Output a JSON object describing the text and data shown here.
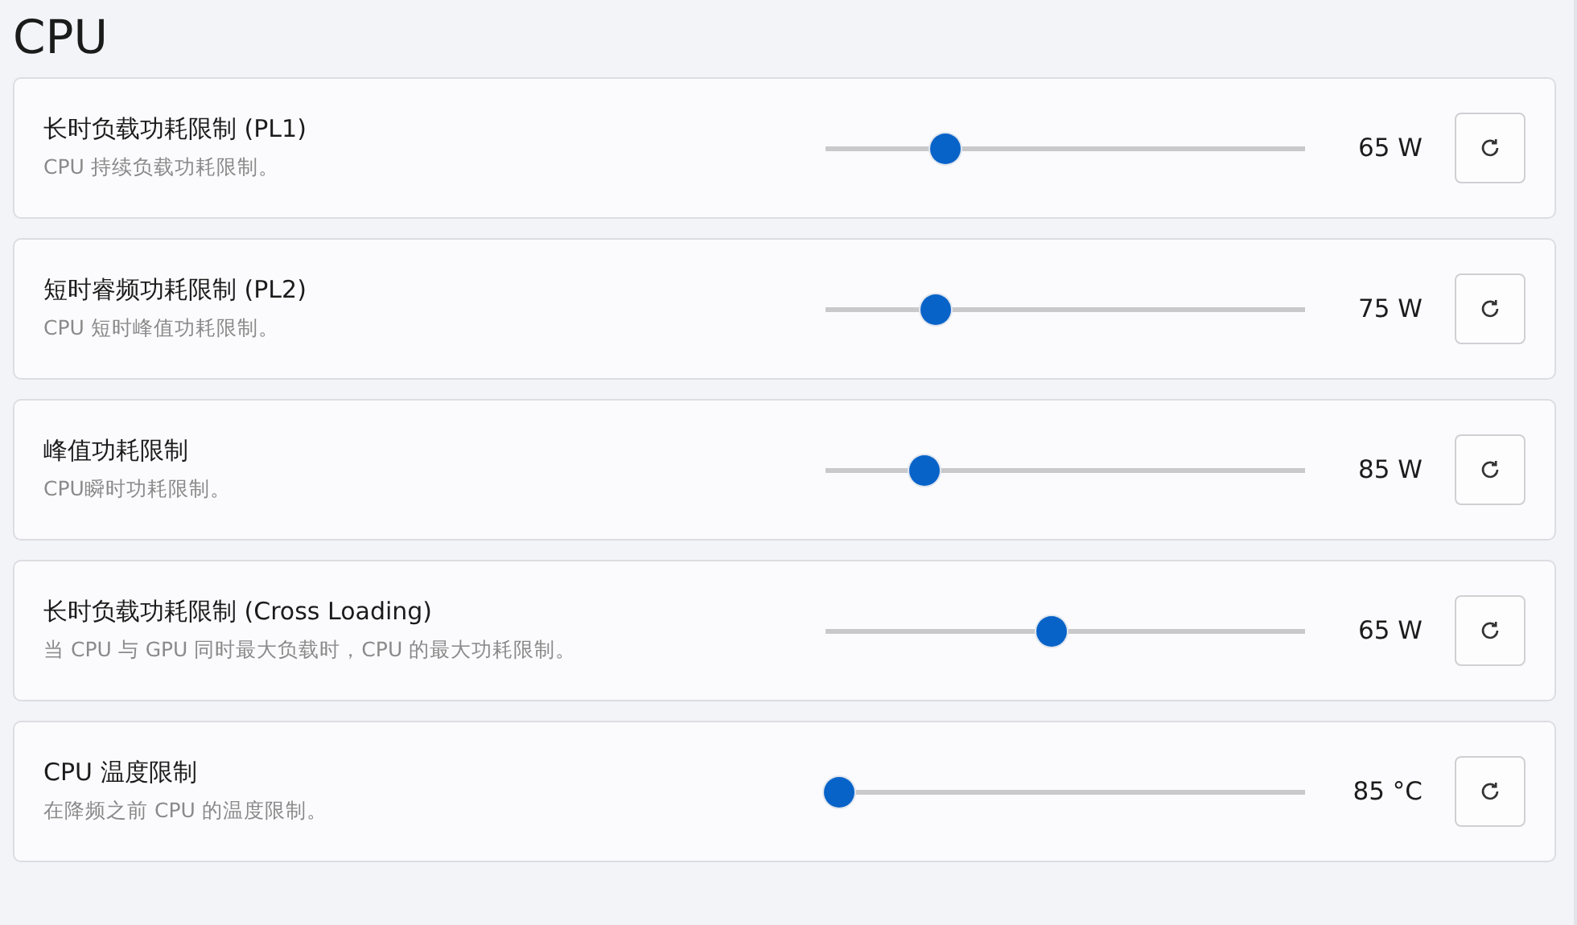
{
  "section": {
    "title": "CPU"
  },
  "settings": [
    {
      "title": "长时负载功耗限制 (PL1)",
      "description": "CPU 持续负载功耗限制。",
      "level": 0.25,
      "reading": "65 W"
    },
    {
      "title": "短时睿频功耗限制 (PL2)",
      "description": "CPU 短时峰值功耗限制。",
      "level": 0.23,
      "reading": "75 W"
    },
    {
      "title": "峰值功耗限制",
      "description": "CPU瞬时功耗限制。",
      "level": 0.205,
      "reading": "85 W"
    },
    {
      "title": "长时负载功耗限制 (Cross Loading)",
      "description": "当 CPU 与 GPU 同时最大负载时，CPU 的最大功耗限制。",
      "level": 0.47,
      "reading": "65 W"
    },
    {
      "title": "CPU 温度限制",
      "description": "在降频之前 CPU 的温度限制。",
      "level": 0.03,
      "reading": "85 °C"
    }
  ]
}
